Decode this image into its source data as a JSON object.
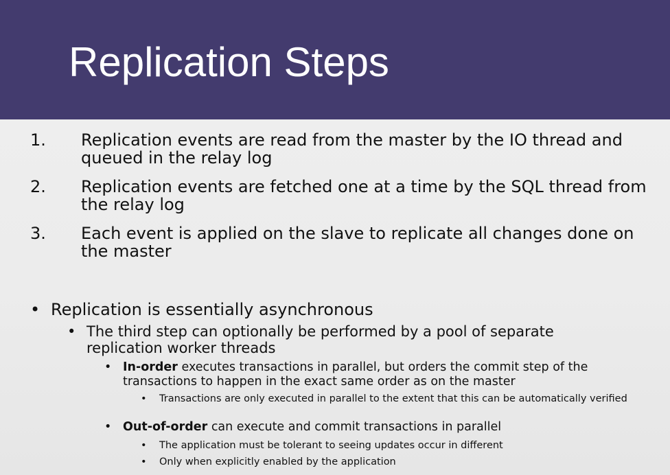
{
  "slide": {
    "title": "Replication Steps",
    "colors": {
      "title_bar": "#433b6e",
      "title_text": "#ffffff",
      "background": "#ececec",
      "text": "#111111"
    },
    "steps": [
      {
        "number": "1.",
        "text": "Replication events are read from the master by the IO thread and queued in the relay log"
      },
      {
        "number": "2.",
        "text": "Replication events are fetched one at a time by the SQL thread from the relay log"
      },
      {
        "number": "3.",
        "text": "Each event is applied on the slave to replicate all changes done on the master"
      }
    ],
    "bullets": {
      "async": "Replication is essentially asynchronous",
      "third_step": "The third step can optionally be performed by a pool of separate replication worker threads",
      "in_order": {
        "label": "In-order",
        "text": " executes transactions in parallel, but orders the commit step of the transactions to happen in the exact same order as on the master",
        "sub": "Transactions are only executed in parallel to the extent that this can be automatically verified"
      },
      "out_of_order": {
        "label": "Out-of-order",
        "text": " can execute and commit transactions in parallel",
        "subs": [
          "The application must be tolerant to seeing updates occur in different",
          "Only when explicitly enabled by the application"
        ]
      }
    }
  }
}
